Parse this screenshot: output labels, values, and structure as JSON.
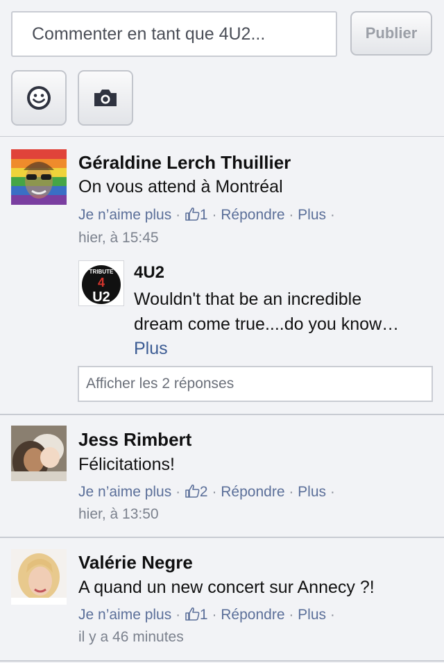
{
  "composer": {
    "placeholder": "Commenter en tant que 4U2...",
    "publish_label": "Publier",
    "emoji_icon": "smiley-icon",
    "camera_icon": "camera-icon"
  },
  "comments": [
    {
      "author": "Géraldine Lerch Thuillier",
      "text": "On vous attend à Montréal",
      "unlike": "Je n’aime plus",
      "likes": "1",
      "reply": "Répondre",
      "more": "Plus",
      "time": "hier, à 15:45",
      "reply_block": {
        "author": "4U2",
        "avatar_text": "TRIBUTE 4 U2",
        "line1": "Wouldn't that be an incredible",
        "line2": "dream come true....do you know…",
        "more": "Plus"
      },
      "show_replies": "Afficher les 2 réponses"
    },
    {
      "author": "Jess Rimbert",
      "text": "Félicitations!",
      "unlike": "Je n’aime plus",
      "likes": "2",
      "reply": "Répondre",
      "more": "Plus",
      "time": "hier, à 13:50"
    },
    {
      "author": "Valérie Negre",
      "text": "A quand un new concert sur Annecy ?!",
      "unlike": "Je n’aime plus",
      "likes": "1",
      "reply": "Répondre",
      "more": "Plus",
      "time": "il y a 46 minutes"
    }
  ],
  "colors": {
    "link": "#5b6f99",
    "meta": "#7b818d",
    "background": "#f2f3f6"
  }
}
